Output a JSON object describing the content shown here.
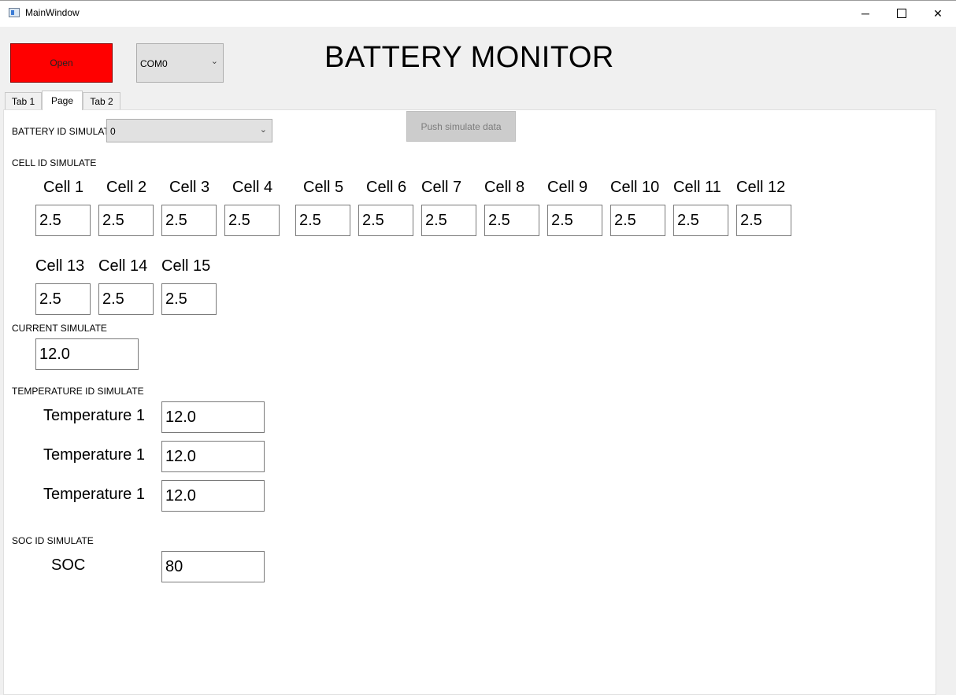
{
  "window": {
    "title": "MainWindow",
    "controls": {
      "minimize": "─",
      "close": "✕"
    }
  },
  "header": {
    "open_button": "Open",
    "com_port": "COM0",
    "app_title": "BATTERY MONITOR"
  },
  "tabs": [
    {
      "label": "Tab 1"
    },
    {
      "label": "Page"
    },
    {
      "label": "Tab 2"
    }
  ],
  "battery_id": {
    "label": "BATTERY ID SIMULATE",
    "value": "0"
  },
  "push_button": "Push simulate data",
  "cells": {
    "label": "CELL ID SIMULATE",
    "items": [
      {
        "label": "Cell 1",
        "value": "2.5"
      },
      {
        "label": "Cell 2",
        "value": "2.5"
      },
      {
        "label": "Cell 3",
        "value": "2.5"
      },
      {
        "label": "Cell 4",
        "value": "2.5"
      },
      {
        "label": "Cell 5",
        "value": "2.5"
      },
      {
        "label": "Cell 6",
        "value": "2.5"
      },
      {
        "label": "Cell 7",
        "value": "2.5"
      },
      {
        "label": "Cell 8",
        "value": "2.5"
      },
      {
        "label": "Cell 9",
        "value": "2.5"
      },
      {
        "label": "Cell 10",
        "value": "2.5"
      },
      {
        "label": "Cell 11",
        "value": "2.5"
      },
      {
        "label": "Cell 12",
        "value": "2.5"
      },
      {
        "label": "Cell 13",
        "value": "2.5"
      },
      {
        "label": "Cell 14",
        "value": "2.5"
      },
      {
        "label": "Cell 15",
        "value": "2.5"
      }
    ]
  },
  "current": {
    "label": "CURRENT SIMULATE",
    "value": "12.0"
  },
  "temperature": {
    "label": "TEMPERATURE ID SIMULATE",
    "items": [
      {
        "label": "Temperature 1",
        "value": "12.0"
      },
      {
        "label": "Temperature 1",
        "value": "12.0"
      },
      {
        "label": "Temperature 1",
        "value": "12.0"
      }
    ]
  },
  "soc": {
    "label": "SOC ID SIMULATE",
    "name": "SOC",
    "value": "80"
  }
}
